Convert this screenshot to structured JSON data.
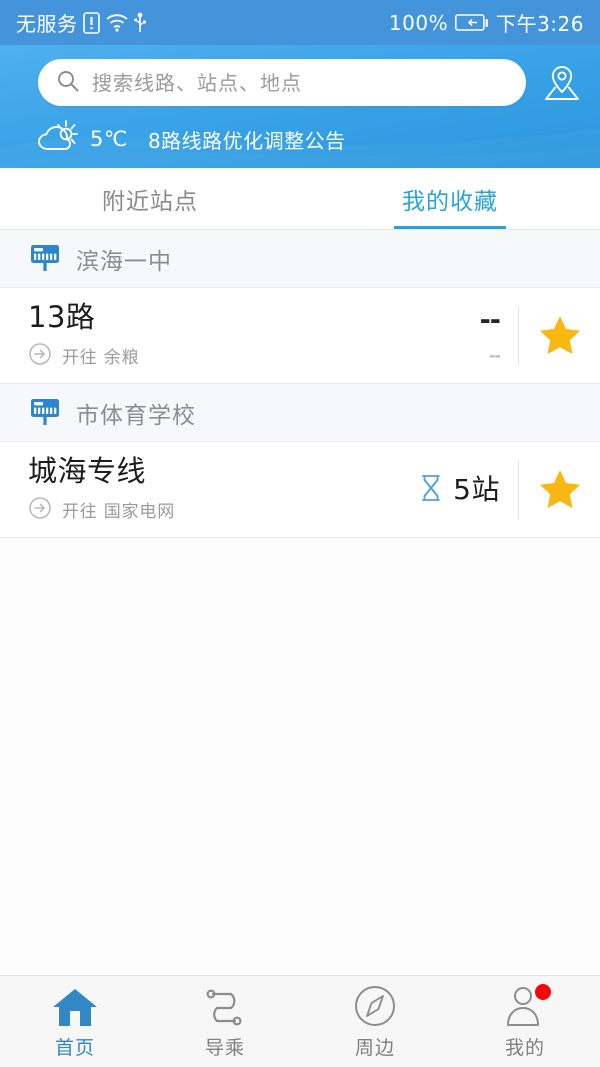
{
  "statusbar": {
    "carrier": "无服务",
    "battery_percent": "100%",
    "time": "下午3:26",
    "icons": [
      "sim-warning-icon",
      "wifi-icon",
      "usb-icon",
      "battery-icon"
    ]
  },
  "header": {
    "search": {
      "placeholder": "搜索线路、站点、地点",
      "icon": "search-icon"
    },
    "map_pin_icon": "map-location-pin-icon",
    "weather": {
      "icon": "partly-cloudy-icon",
      "temperature": "5℃",
      "notice": "8路线路优化调整公告"
    },
    "accent": "#2aa3d8"
  },
  "tabs": [
    {
      "label": "附近站点",
      "active": false
    },
    {
      "label": "我的收藏",
      "active": true
    }
  ],
  "groups": [
    {
      "station_icon": "bus-stop-sign-icon",
      "station": "滨海一中",
      "routes": [
        {
          "name": "13路",
          "direction_icon": "arrow-circle-right-icon",
          "direction": "开往 余粮",
          "eta_icon": "",
          "eta": "--",
          "eta_sub": "--",
          "favorite_icon": "star-filled-icon",
          "favorite": true
        }
      ]
    },
    {
      "station_icon": "bus-stop-sign-icon",
      "station": "市体育学校",
      "routes": [
        {
          "name": "城海专线",
          "direction_icon": "arrow-circle-right-icon",
          "direction": "开往 国家电网",
          "eta_icon": "hourglass-icon",
          "eta": "5站",
          "eta_sub": "",
          "favorite_icon": "star-filled-icon",
          "favorite": true
        }
      ]
    }
  ],
  "bottomnav": [
    {
      "label": "首页",
      "icon": "home-icon",
      "active": true,
      "badge": false
    },
    {
      "label": "导乘",
      "icon": "route-path-icon",
      "active": false,
      "badge": false
    },
    {
      "label": "周边",
      "icon": "compass-icon",
      "active": false,
      "badge": false
    },
    {
      "label": "我的",
      "icon": "person-icon",
      "active": false,
      "badge": true
    }
  ],
  "colors": {
    "header_blue": "#3aa3e7",
    "status_blue": "#4494dc",
    "accent": "#2aa3d8",
    "star_yellow": "#f9b712",
    "badge_red": "#fa0505",
    "nav_active": "#3288c4"
  }
}
